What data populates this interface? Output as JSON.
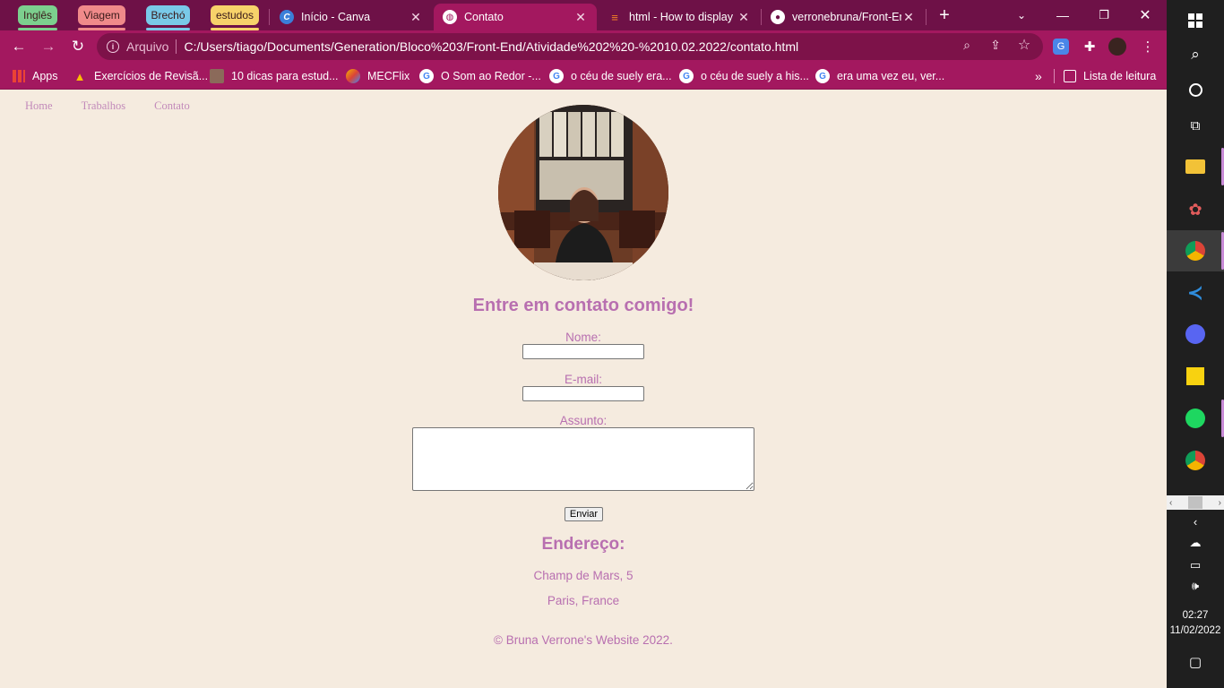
{
  "browser": {
    "tab_groups": [
      {
        "label": "Inglês",
        "color": "#7ccf8e"
      },
      {
        "label": "Viagem",
        "color": "#f08a8a"
      },
      {
        "label": "Brechó",
        "color": "#79c9e8"
      },
      {
        "label": "estudos",
        "color": "#f7d26a"
      }
    ],
    "tabs": [
      {
        "title": "Início - Canva",
        "active": false
      },
      {
        "title": "Contato",
        "active": true
      },
      {
        "title": "html - How to display",
        "active": false
      },
      {
        "title": "verronebruna/Front-End",
        "active": false
      }
    ],
    "address": {
      "protocol_label": "Arquivo",
      "url": "C:/Users/tiago/Documents/Generation/Bloco%203/Front-End/Atividade%202%20-%2010.02.2022/contato.html"
    },
    "bookmarks": [
      {
        "label": "Apps"
      },
      {
        "label": "Exercícios de Revisã..."
      },
      {
        "label": "10 dicas para estud..."
      },
      {
        "label": "MECFlix"
      },
      {
        "label": "O Som ao Redor -..."
      },
      {
        "label": "o céu de suely era..."
      },
      {
        "label": "o céu de suely a his..."
      },
      {
        "label": "era uma vez eu, ver..."
      }
    ],
    "reading_list_label": "Lista de leitura"
  },
  "page": {
    "nav": [
      "Home",
      "Trabalhos",
      "Contato"
    ],
    "heading": "Entre em contato comigo!",
    "form": {
      "name_label": "Nome:",
      "email_label": "E-mail:",
      "subject_label": "Assunto:",
      "submit_label": "Enviar"
    },
    "address_heading": "Endereço:",
    "address_lines": [
      "Champ de Mars, 5",
      "Paris, France"
    ],
    "footer": "© Bruna Verrone's Website 2022."
  },
  "taskbar": {
    "time": "02:27",
    "date": "11/02/2022"
  }
}
